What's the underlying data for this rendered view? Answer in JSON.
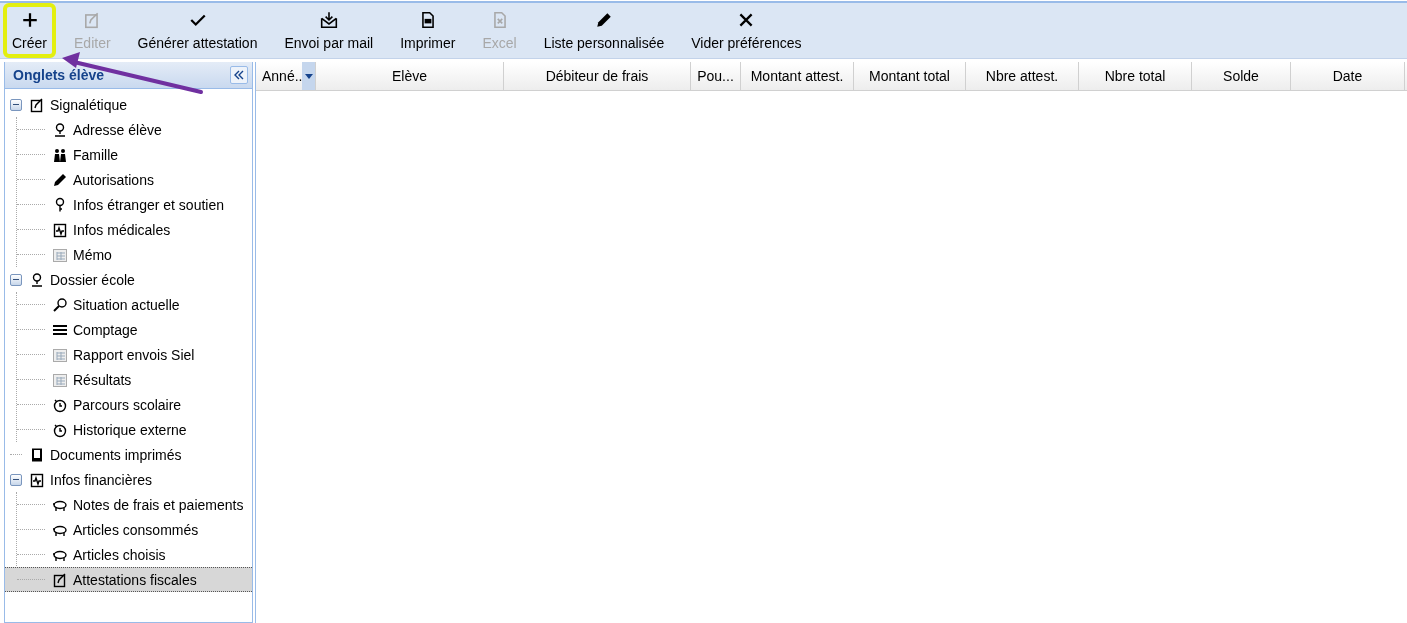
{
  "toolbar": [
    {
      "label": "Créer",
      "kind": "plus",
      "disabled": false,
      "highlighted": true
    },
    {
      "label": "Editer",
      "kind": "edit",
      "disabled": true,
      "highlighted": false
    },
    {
      "label": "Générer attestation",
      "kind": "check",
      "disabled": false,
      "highlighted": false
    },
    {
      "label": "Envoi par mail",
      "kind": "mail",
      "disabled": false,
      "highlighted": false
    },
    {
      "label": "Imprimer",
      "kind": "pdf",
      "disabled": false,
      "highlighted": false
    },
    {
      "label": "Excel",
      "kind": "excel",
      "disabled": true,
      "highlighted": false
    },
    {
      "label": "Liste personnalisée",
      "kind": "pencil",
      "disabled": false,
      "highlighted": false
    },
    {
      "label": "Vider préférences",
      "kind": "cross",
      "disabled": false,
      "highlighted": false
    }
  ],
  "sidebar": {
    "title": "Onglets élève",
    "tree": [
      {
        "label": "Signalétique",
        "kind": "edit",
        "expanded": true,
        "selected": false,
        "children": [
          {
            "label": "Adresse élève",
            "kind": "pin",
            "selected": false
          },
          {
            "label": "Famille",
            "kind": "family",
            "selected": false
          },
          {
            "label": "Autorisations",
            "kind": "pencil",
            "selected": false
          },
          {
            "label": "Infos étranger et soutien",
            "kind": "key",
            "selected": false
          },
          {
            "label": "Infos médicales",
            "kind": "medical",
            "selected": false
          },
          {
            "label": "Mémo",
            "kind": "table",
            "selected": false
          }
        ]
      },
      {
        "label": "Dossier école",
        "kind": "pin",
        "expanded": true,
        "selected": false,
        "children": [
          {
            "label": "Situation actuelle",
            "kind": "search",
            "selected": false
          },
          {
            "label": "Comptage",
            "kind": "lines",
            "selected": false
          },
          {
            "label": "Rapport envois Siel",
            "kind": "table",
            "selected": false
          },
          {
            "label": "Résultats",
            "kind": "table",
            "selected": false
          },
          {
            "label": "Parcours scolaire",
            "kind": "clock",
            "selected": false
          },
          {
            "label": "Historique externe",
            "kind": "clock",
            "selected": false
          }
        ]
      },
      {
        "label": "Documents imprimés",
        "kind": "book",
        "selected": false
      },
      {
        "label": "Infos financières",
        "kind": "medical",
        "expanded": true,
        "selected": false,
        "children": [
          {
            "label": "Notes de frais et paiements",
            "kind": "pig",
            "selected": false
          },
          {
            "label": "Articles consommés",
            "kind": "pig",
            "selected": false
          },
          {
            "label": "Articles choisis",
            "kind": "pig",
            "selected": false
          },
          {
            "label": "Attestations fiscales",
            "kind": "edit",
            "selected": true
          }
        ]
      }
    ]
  },
  "table": {
    "columns": [
      {
        "label": "Anné..",
        "sortable": true
      },
      {
        "label": "Elève",
        "sortable": false
      },
      {
        "label": "Débiteur de frais",
        "sortable": false
      },
      {
        "label": "Pou...",
        "sortable": false
      },
      {
        "label": "Montant attest.",
        "sortable": false
      },
      {
        "label": "Montant total",
        "sortable": false
      },
      {
        "label": "Nbre attest.",
        "sortable": false
      },
      {
        "label": "Nbre total",
        "sortable": false
      },
      {
        "label": "Solde",
        "sortable": false
      },
      {
        "label": "Date",
        "sortable": false
      }
    ]
  }
}
